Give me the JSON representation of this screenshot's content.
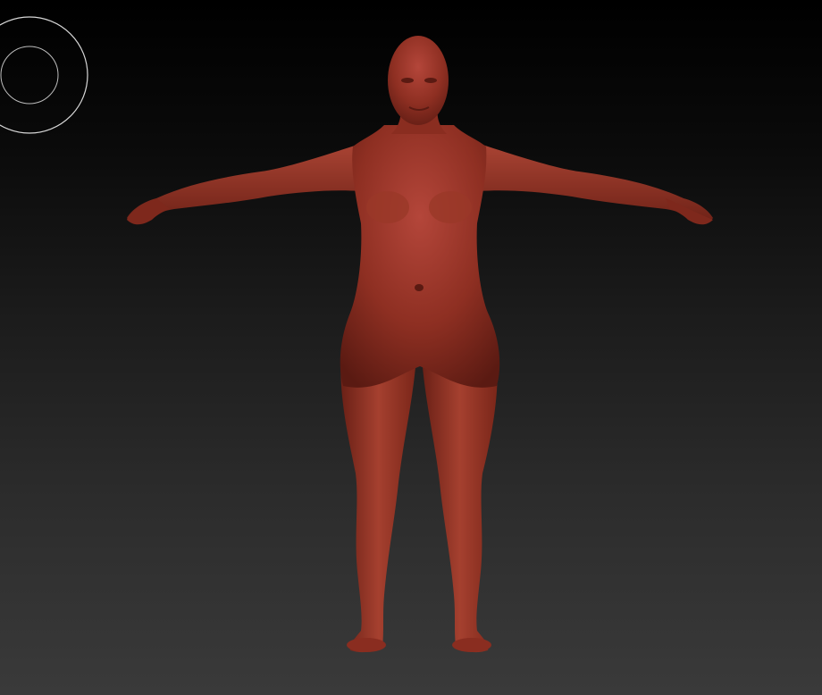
{
  "viewport": {
    "background_top": "#000000",
    "background_bottom": "#3a3a3a"
  },
  "navigation_gizmo": {
    "icon": "rotate-navigation-circle-icon",
    "ring_color": "#d8d8d8"
  },
  "model": {
    "pose": "a-pose",
    "subject": "female-body-sculpt",
    "material_color": "#8e2f22",
    "highlight_color": "#c0503c",
    "shadow_color": "#4a140e"
  }
}
